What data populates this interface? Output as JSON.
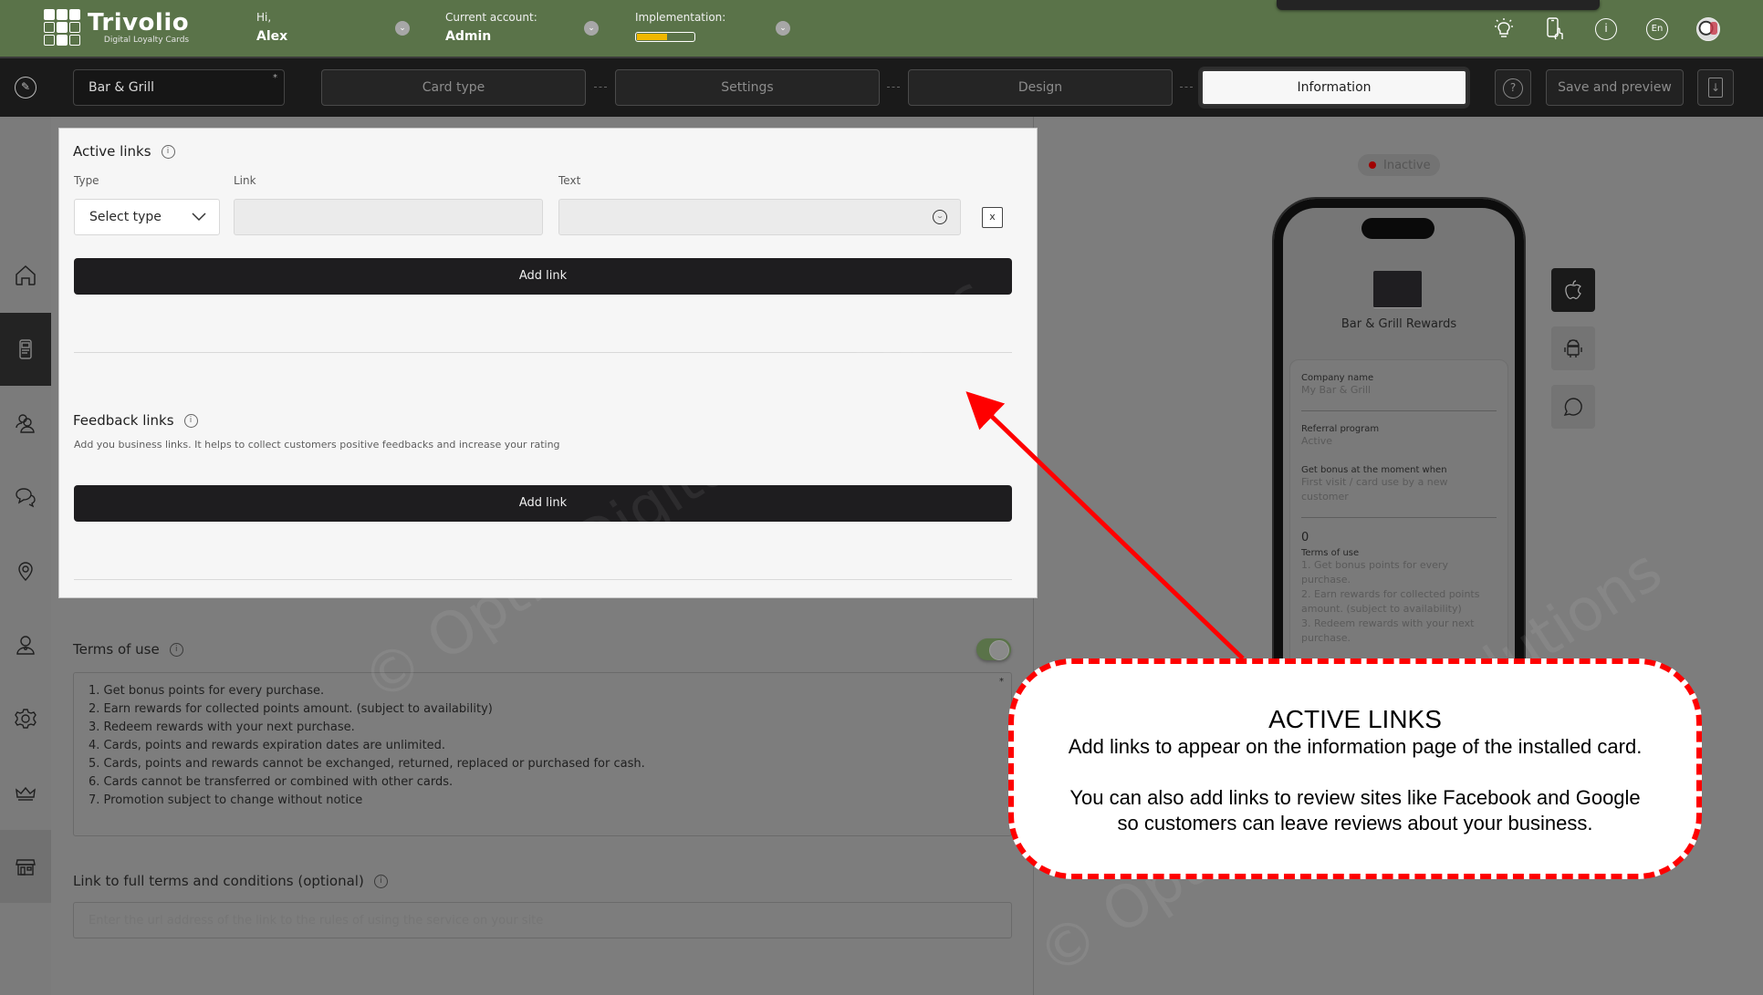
{
  "header": {
    "logo_name": "Trivolio",
    "logo_tagline": "Digital Loyalty Cards",
    "greeting_label": "Hi,",
    "user_name": "Alex",
    "account_label": "Current account:",
    "account_value": "Admin",
    "implementation_label": "Implementation:",
    "implementation_progress_percent": 55,
    "icons": [
      "lightbulb-icon",
      "phone-touch-icon",
      "info-icon",
      "language-icon",
      "avatar"
    ],
    "language": "En"
  },
  "nav": {
    "card_name": "Bar & Grill",
    "card_name_required_mark": "*",
    "steps": [
      {
        "label": "Card type",
        "active": false
      },
      {
        "label": "Settings",
        "active": false
      },
      {
        "label": "Design",
        "active": false
      },
      {
        "label": "Information",
        "active": true
      }
    ],
    "help_label": "?",
    "save_label": "Save and preview"
  },
  "sidebar": {
    "items": [
      {
        "name": "home",
        "active": false
      },
      {
        "name": "cards",
        "active": true
      },
      {
        "name": "customers",
        "active": false
      },
      {
        "name": "messages",
        "active": false
      },
      {
        "name": "locations",
        "active": false
      },
      {
        "name": "managers",
        "active": false
      },
      {
        "name": "settings",
        "active": false
      },
      {
        "name": "subscription",
        "active": false
      },
      {
        "name": "store",
        "active": false
      }
    ]
  },
  "active_links": {
    "title": "Active links",
    "type_label": "Type",
    "link_label": "Link",
    "text_label": "Text",
    "type_placeholder": "Select type",
    "link_value": "",
    "text_value": "",
    "remove_label": "x",
    "add_label": "Add link"
  },
  "feedback_links": {
    "title": "Feedback links",
    "helper": "Add you business links. It helps to collect customers positive feedbacks and increase your rating",
    "add_label": "Add link"
  },
  "terms": {
    "title": "Terms of use",
    "enabled": true,
    "required_mark": "*",
    "lines": [
      "1. Get bonus points for every purchase.",
      "2. Earn rewards for collected points amount. (subject to availability)",
      "3. Redeem rewards with your next purchase.",
      "4. Cards, points and rewards expiration dates are unlimited.",
      "5. Cards, points and rewards cannot be exchanged, returned, replaced or purchased for cash.",
      "6. Cards cannot be transferred or combined with other cards.",
      "7. Promotion subject to change without notice"
    ]
  },
  "terms_link": {
    "title": "Link to full terms and conditions (optional)",
    "placeholder": "Enter the url address of the link to the rules of using the service on your site",
    "value": ""
  },
  "preview": {
    "status": "Inactive",
    "status_color": "#a00000",
    "card_title": "Bar & Grill Rewards",
    "company_label": "Company name",
    "company_value": "My Bar & Grill",
    "referral_label": "Referral program",
    "referral_value": "Active",
    "bonus_label": "Get bonus at the moment when",
    "bonus_value": "First visit / card use by a new customer",
    "count": "0",
    "terms_label": "Terms of use",
    "terms_lines": [
      "1. Get bonus points for every purchase.",
      "2. Earn rewards for collected points amount. (subject to availability)",
      "3. Redeem rewards with your next purchase."
    ],
    "platforms": [
      "apple",
      "android",
      "message"
    ]
  },
  "watermark": "© Optix Digital Solutions",
  "callout": {
    "title": "ACTIVE LINKS",
    "line1": "Add links to appear on the information page of the installed card.",
    "line2": "You can also add links to review sites like Facebook and Google",
    "line3": "so customers can leave reviews about your business.",
    "border_color": "#ff0000"
  }
}
